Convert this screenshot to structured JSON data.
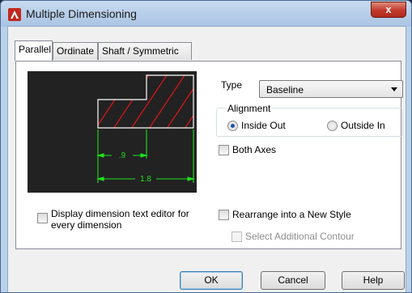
{
  "window": {
    "title": "Multiple Dimensioning",
    "close_label": "x"
  },
  "tabs": [
    {
      "label": "Parallel",
      "active": true
    },
    {
      "label": "Ordinate",
      "active": false
    },
    {
      "label": "Shaft / Symmetric",
      "active": false
    }
  ],
  "preview": {
    "dim_short": ".9",
    "dim_long": "1.8"
  },
  "type": {
    "label": "Type",
    "value": "Baseline"
  },
  "alignment": {
    "label": "Alignment",
    "options": [
      {
        "label": "Inside Out",
        "selected": true
      },
      {
        "label": "Outside In",
        "selected": false
      }
    ]
  },
  "both_axes": {
    "label": "Both Axes",
    "checked": false
  },
  "display_editor": {
    "label_line1": "Display dimension text editor for",
    "label_line2": "every dimension",
    "checked": false
  },
  "rearrange": {
    "label": "Rearrange into a New Style",
    "checked": false
  },
  "select_contour": {
    "label": "Select Additional Contour",
    "checked": false,
    "enabled": false
  },
  "buttons": {
    "ok": "OK",
    "cancel": "Cancel",
    "help": "Help"
  }
}
